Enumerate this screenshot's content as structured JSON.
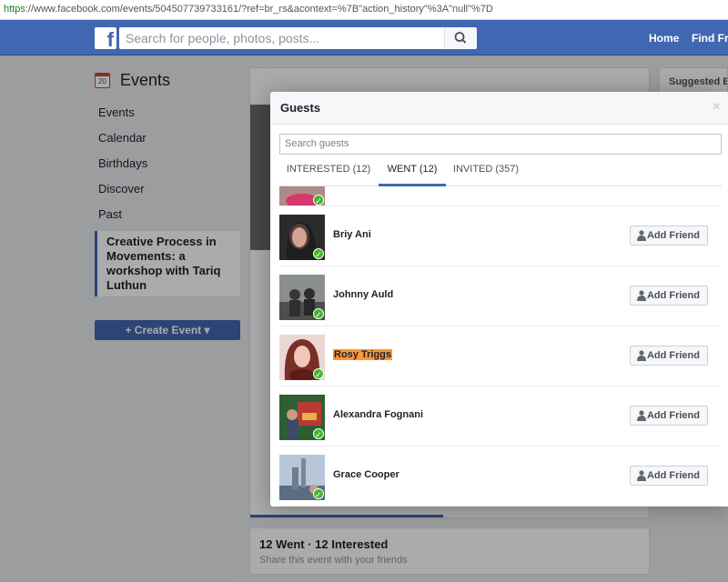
{
  "browser": {
    "url_scheme": "https",
    "url_rest": "://www.facebook.com/events/504507739733161/?ref=br_rs&acontext=%7B\"action_history\"%3A\"null\"%7D"
  },
  "topbar": {
    "logo": "f",
    "search_placeholder": "Search for people, photos, posts...",
    "nav": [
      "Home",
      "Find Fri"
    ]
  },
  "sidebar": {
    "calendar_day": "20",
    "title": "Events",
    "items": [
      "Events",
      "Calendar",
      "Birthdays",
      "Discover",
      "Past"
    ],
    "selected_event": "Creative Process in Movements: a workshop with Tariq Luthun",
    "create_button": "Create Event"
  },
  "right_panel": {
    "title": "Suggested Ev"
  },
  "event_summary": {
    "counts": "12 Went · 12 Interested",
    "share": "Share this event with your friends"
  },
  "dialog": {
    "title": "Guests",
    "close": "×",
    "search_placeholder": "Search guests",
    "tabs": [
      {
        "label": "INTERESTED (12)",
        "active": false
      },
      {
        "label": "WENT (12)",
        "active": true
      },
      {
        "label": "INVITED (357)",
        "active": false
      }
    ],
    "add_friend_label": "Add Friend",
    "guests": [
      {
        "name": "Briy Ani",
        "highlighted": false
      },
      {
        "name": "Johnny Auld",
        "highlighted": false
      },
      {
        "name": "Rosy Triggs",
        "highlighted": true
      },
      {
        "name": "Alexandra Fognani",
        "highlighted": false
      },
      {
        "name": "Grace Cooper",
        "highlighted": false
      }
    ]
  },
  "colors": {
    "brand": "#4267b2",
    "went_check": "#42b72a",
    "highlight": "#ff9632"
  }
}
